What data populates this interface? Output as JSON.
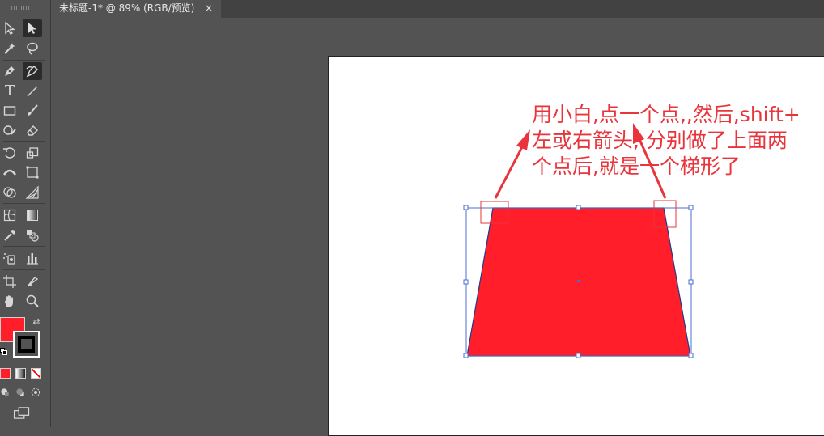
{
  "tab": {
    "title": "未标题-1* @ 89% (RGB/预览)",
    "close": "×"
  },
  "annotation": {
    "lines": [
      "用小白,点一个点,,然后,shift+",
      "左或右箭头, 分别做了上面两",
      "个点后,就是一个梯形了"
    ],
    "color": "#e8343a"
  },
  "shape": {
    "fill": "#ff1e2a",
    "outline": "#1e3c8c",
    "bounding_box": "#4a6fd0"
  },
  "toolbar": {
    "icons": [
      "selection-icon",
      "direct-selection-icon",
      "magic-wand-icon",
      "lasso-icon",
      "pen-icon",
      "curvature-icon",
      "type-icon",
      "line-icon",
      "rectangle-icon",
      "paintbrush-icon",
      "shaper-icon",
      "eraser-icon",
      "rotate-icon",
      "scale-icon",
      "width-icon",
      "free-transform-icon",
      "shape-builder-icon",
      "perspective-grid-icon",
      "mesh-icon",
      "gradient-icon",
      "eyedropper-icon",
      "blend-icon",
      "symbol-sprayer-icon",
      "column-graph-icon",
      "artboard-icon",
      "slice-icon",
      "hand-icon",
      "zoom-icon"
    ],
    "fill_color": "#ff1e2a",
    "stroke_color": "#000000"
  }
}
